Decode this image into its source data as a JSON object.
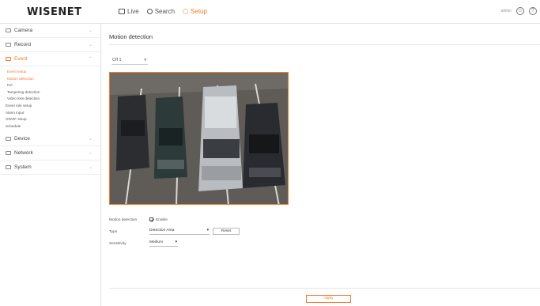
{
  "brand": {
    "logo": "WISENET",
    "accent": "#f07a2e"
  },
  "topnav": [
    {
      "label": "Live",
      "icon": "monitor-icon",
      "active": false
    },
    {
      "label": "Search",
      "icon": "search-icon",
      "active": false
    },
    {
      "label": "Setup",
      "icon": "gear-icon",
      "active": true
    }
  ],
  "header_right": {
    "user": "admin",
    "help": "?"
  },
  "sidebar": {
    "menus": [
      {
        "label": "Camera",
        "icon": "camera-icon"
      },
      {
        "label": "Record",
        "icon": "record-icon"
      },
      {
        "label": "Event",
        "icon": "event-icon",
        "active": true
      }
    ],
    "event_items": [
      "Event setup",
      "Motion detection",
      "IVA",
      "Tampering detection",
      "Video loss detection",
      "Event rule setup",
      "Alarm input",
      "ONVIF setup",
      "Schedule"
    ],
    "menus_after": [
      {
        "label": "Device",
        "icon": "device-icon"
      },
      {
        "label": "Network",
        "icon": "network-icon"
      },
      {
        "label": "System",
        "icon": "system-icon"
      }
    ]
  },
  "main": {
    "title": "Motion detection",
    "channel": "CH 1",
    "motion_detection_label": "Motion detection",
    "enable_label": "Enable",
    "enable_checked": true,
    "type_label": "Type",
    "type_value": "Detection Area",
    "reset_label": "Reset",
    "sensitivity_label": "Sensitivity",
    "sensitivity_value": "Medium",
    "apply_label": "Apply"
  }
}
